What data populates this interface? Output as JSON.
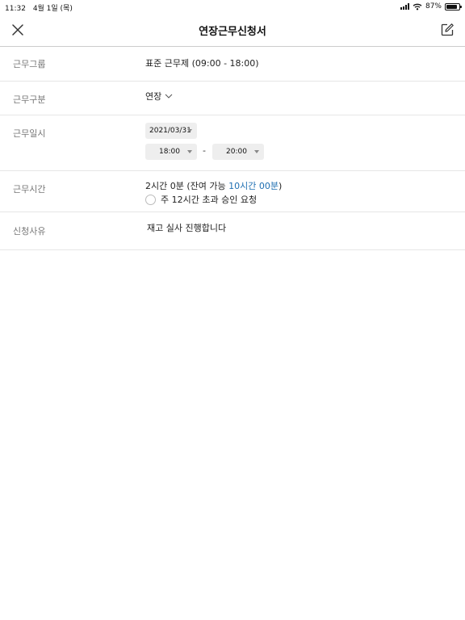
{
  "status_bar": {
    "time": "11:32",
    "date": "4월 1일 (목)",
    "battery_percent": "87%",
    "battery_level": 0.87
  },
  "nav": {
    "title": "연장근무신청서",
    "close_icon": "close-icon",
    "edit_icon": "edit-icon"
  },
  "form": {
    "work_group": {
      "label": "근무그룹",
      "value": "표준 근무제 (09:00 - 18:00)"
    },
    "work_type": {
      "label": "근무구분",
      "value": "연장",
      "icon": "chevron-down-icon"
    },
    "work_datetime": {
      "label": "근무일시",
      "date": "2021/03/31",
      "start_time": "18:00",
      "separator": "-",
      "end_time": "20:00"
    },
    "work_hours": {
      "label": "근무시간",
      "value_prefix": "2시간 0분 (잔여 가능 ",
      "remaining": "10시간 00분",
      "value_suffix": ")",
      "approval_label": "주 12시간 초과 승인 요청",
      "approval_checked": false
    },
    "reason": {
      "label": "신청사유",
      "value": "재고 실사 진행합니다"
    }
  },
  "colors": {
    "accent": "#1f6fb2",
    "label": "#777777",
    "pill_bg": "#eeeeee",
    "divider": "#e6e6e6"
  }
}
